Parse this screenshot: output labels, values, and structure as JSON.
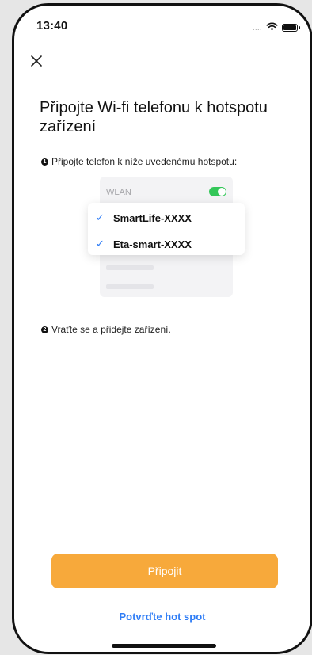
{
  "status_bar": {
    "time": "13:40",
    "signal_dots": "....",
    "icons": [
      "wifi-icon",
      "battery-icon"
    ]
  },
  "header": {
    "close_icon": "close-icon"
  },
  "title": "Připojte Wi-fi telefonu k hotspotu zařízení",
  "steps": [
    {
      "number": "1",
      "text": "Připojte telefon k níže uvedenému hotspotu:"
    },
    {
      "number": "2",
      "text": "Vraťte se a přidejte zařízení."
    }
  ],
  "illustration": {
    "wlan_label": "WLAN",
    "wlan_enabled": true,
    "networks": [
      {
        "check": "✓",
        "ssid": "SmartLife-XXXX"
      },
      {
        "check": "✓",
        "ssid": "Eta-smart-XXXX"
      }
    ]
  },
  "actions": {
    "connect_label": "Připojit",
    "confirm_hotspot_label": "Potvrďte hot spot"
  },
  "colors": {
    "accent": "#f7a93b",
    "link": "#2f7df6",
    "toggle_on": "#34c759"
  }
}
